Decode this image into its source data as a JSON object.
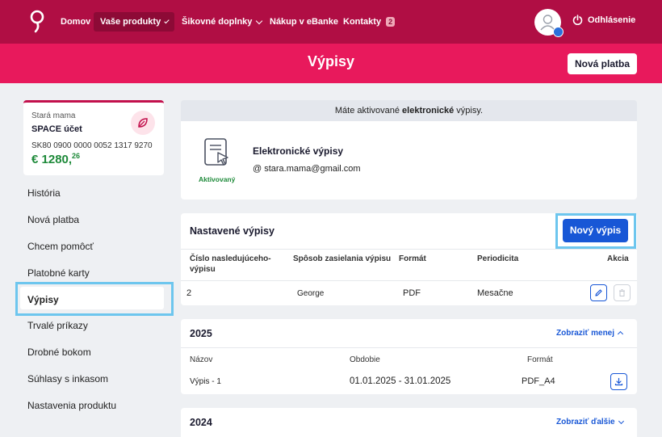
{
  "nav": {
    "items": [
      {
        "label": "Domov"
      },
      {
        "label": "Vaše produkty"
      },
      {
        "label": "Šikovné doplnky"
      },
      {
        "label": "Nákup v eBanke"
      },
      {
        "label": "Kontakty",
        "badge": "2"
      }
    ],
    "logout": "Odhlásenie"
  },
  "header": {
    "title": "Výpisy",
    "new_payment": "Nová platba"
  },
  "account": {
    "owner": "Stará mama",
    "name": "SPACE účet",
    "iban": "SK80 0900 0000 0052 1317 9270",
    "balance_main": "€ 1280,",
    "balance_cents": "26"
  },
  "sidebar": {
    "items": [
      {
        "label": "História"
      },
      {
        "label": "Nová platba"
      },
      {
        "label": "Chcem pomôcť"
      },
      {
        "label": "Platobné karty"
      },
      {
        "label": "Výpisy"
      },
      {
        "label": "Trvalé príkazy"
      },
      {
        "label": "Drobné bokom"
      },
      {
        "label": "Súhlasy s inkasom"
      },
      {
        "label": "Nastavenia produktu"
      }
    ]
  },
  "info": {
    "prefix": "Máte aktivované ",
    "bold": "elektronické",
    "suffix": " výpisy."
  },
  "electronic": {
    "title": "Elektronické výpisy",
    "email": "@ stara.mama@gmail.com",
    "status": "Aktivovaný"
  },
  "configured": {
    "title": "Nastavené výpisy",
    "new_button": "Nový výpis",
    "headers": [
      "Číslo nasledujúceho-výpisu",
      "Spôsob zasielania výpisu",
      "Formát",
      "Periodicita",
      "Akcia"
    ],
    "rows": [
      {
        "number": "2",
        "method": "George",
        "format": "PDF",
        "period": "Mesačne"
      }
    ]
  },
  "year2025": {
    "title": "2025",
    "toggle": "Zobraziť menej",
    "headers": [
      "Názov",
      "Obdobie",
      "Formát"
    ],
    "rows": [
      {
        "name": "Výpis - 1",
        "period": "01.01.2025 - 31.01.2025",
        "format": "PDF_A4"
      }
    ]
  },
  "year2024": {
    "title": "2024",
    "toggle": "Zobraziť ďalšie"
  },
  "colors": {
    "brand_dark": "#b00e44",
    "brand": "#e8195c",
    "primary": "#1857d6",
    "success": "#1e8a3a",
    "highlight": "#6dc6ee"
  }
}
